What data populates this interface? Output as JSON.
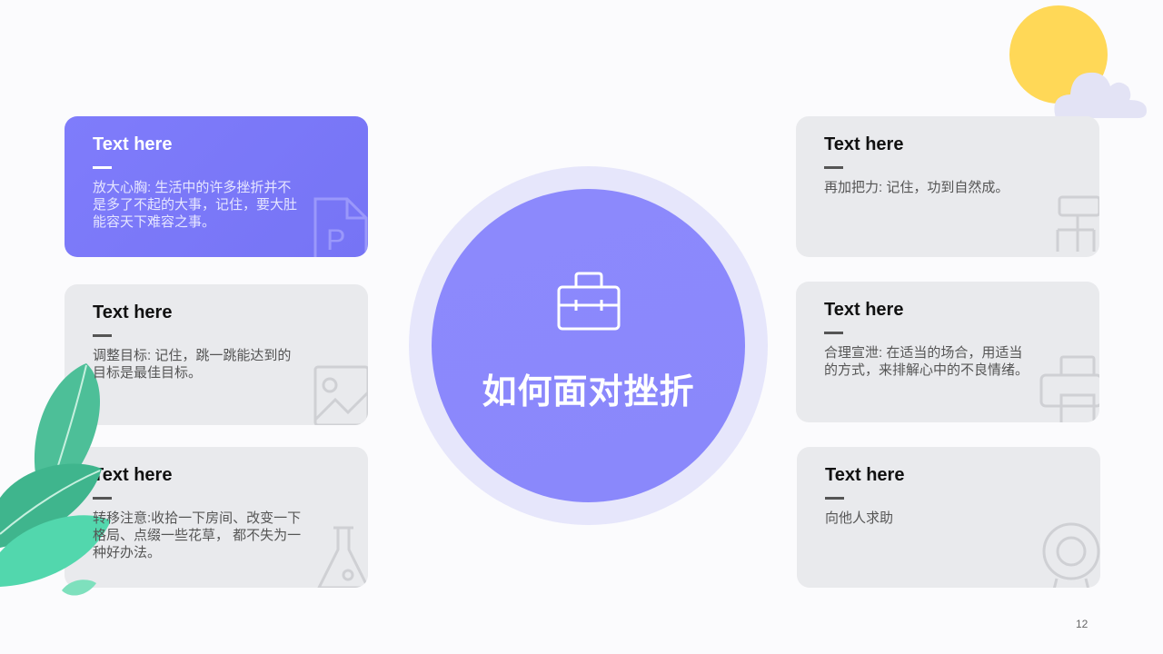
{
  "center": {
    "title": "如何面对挫折",
    "icon": "briefcase-icon"
  },
  "cards_left": [
    {
      "title": "Text here",
      "body": "放大心胸: 生活中的许多挫折并不是多了不起的大事，记住，要大肚能容天下难容之事。",
      "icon": "ppt-file-icon",
      "active": true
    },
    {
      "title": "Text here",
      "body": "调整目标: 记住，跳一跳能达到的目标是最佳目标。",
      "icon": "image-icon",
      "active": false
    },
    {
      "title": "Text here",
      "body": "转移注意:收拾一下房间、改变一下格局、点缀一些花草，   都不失为一种好办法。",
      "icon": "flask-icon",
      "active": false
    }
  ],
  "cards_right": [
    {
      "title": "Text here",
      "body": "再加把力: 记住，功到自然成。",
      "icon": "network-icon",
      "active": false
    },
    {
      "title": "Text here",
      "body": "合理宣泄: 在适当的场合，用适当的方式，来排解心中的不良情绪。",
      "icon": "printer-icon",
      "active": false
    },
    {
      "title": "Text here",
      "body": "向他人求助",
      "icon": "webcam-icon",
      "active": false
    }
  ],
  "page_number": "12",
  "colors": {
    "accent": "#7b78f8",
    "ring": "#e6e6fb",
    "card": "#e9eaed",
    "sun": "#ffd857",
    "cloud": "#e3e3f5",
    "leaf": "#3fbf9a"
  }
}
